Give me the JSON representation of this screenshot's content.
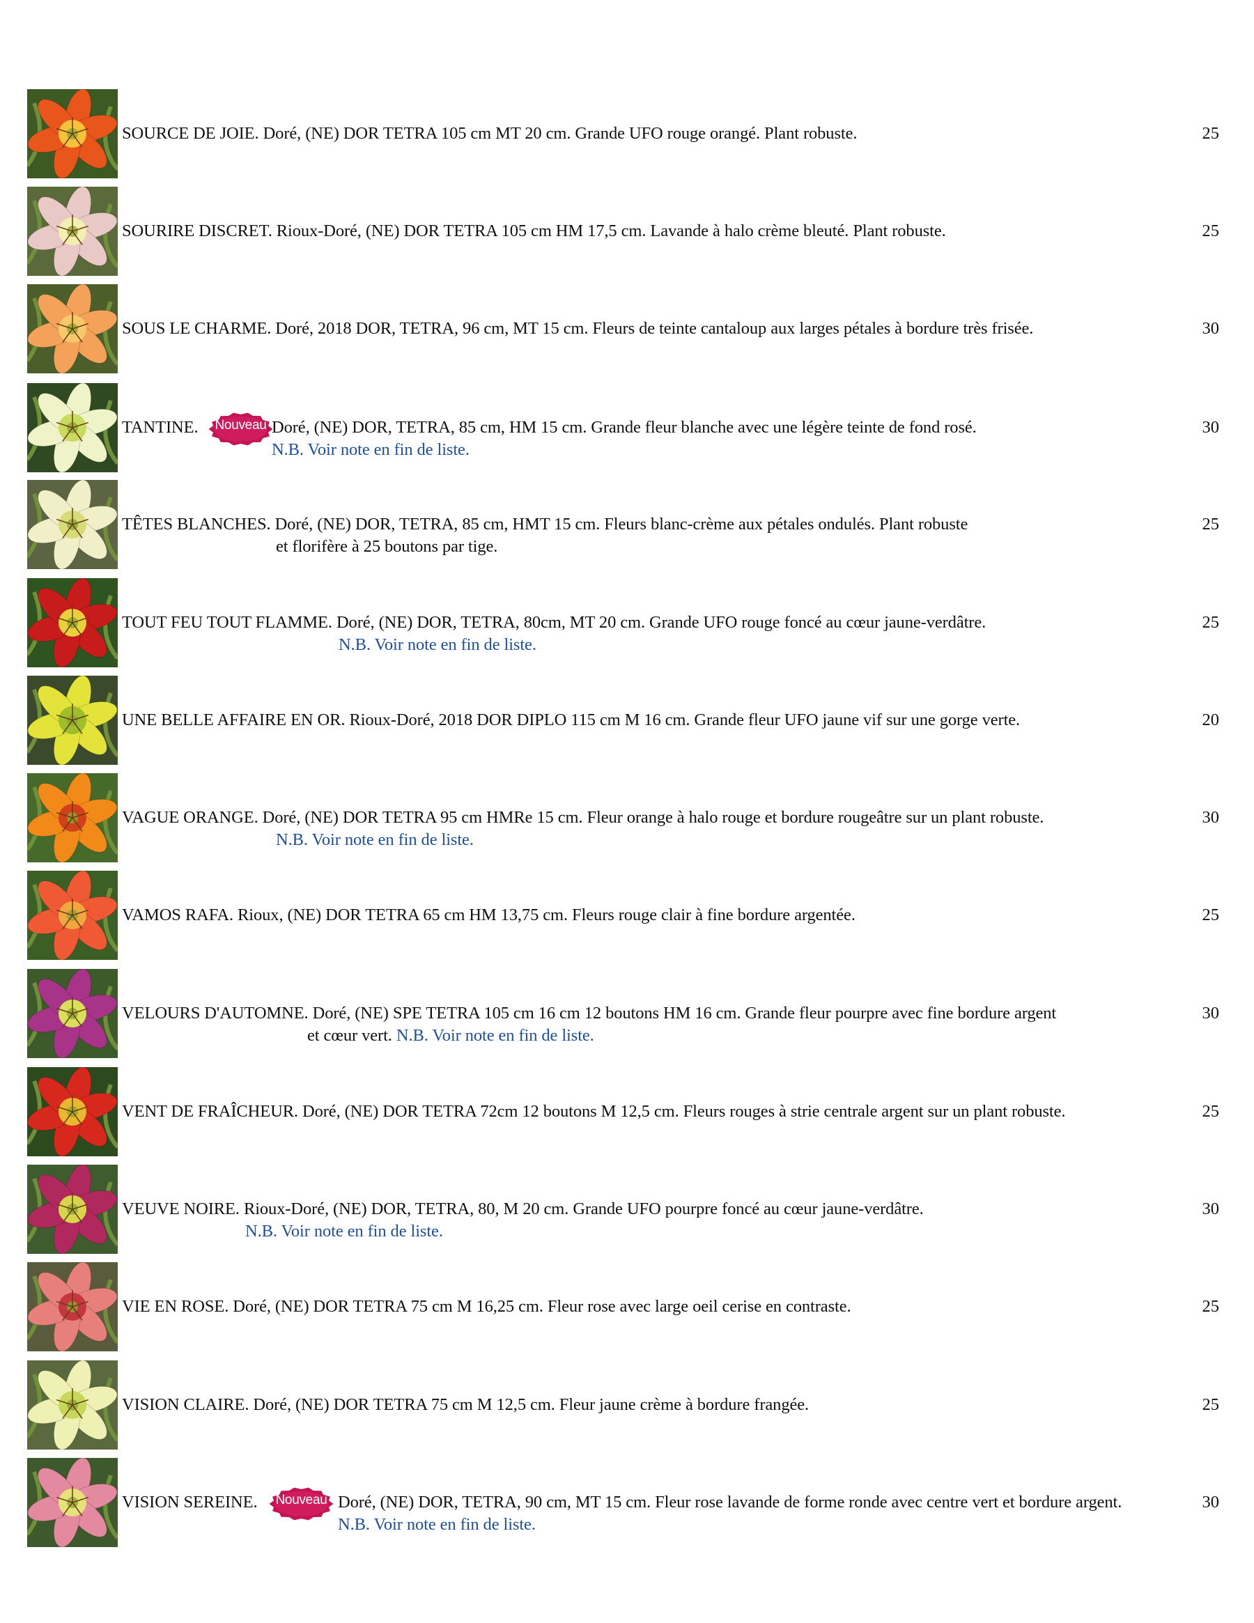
{
  "catalog": {
    "entries": [
      {
        "name": "SOURCE DE JOIE.",
        "description": "Doré, (NE) DOR TETRA 105 cm MT 20 cm. Grande UFO rouge orangé. Plant robuste.",
        "price": "25",
        "image": "daylily-orange-red-photo",
        "colors": {
          "petal": "#e8561c",
          "center": "#f7c23a",
          "bg": "#3d5a23"
        }
      },
      {
        "name": "SOURIRE DISCRET.",
        "description": "Rioux-Doré, (NE) DOR TETRA 105 cm HM 17,5 cm. Lavande à halo crème bleuté. Plant robuste.",
        "price": "25",
        "image": "daylily-lavender-cream-photo",
        "colors": {
          "petal": "#e9c9c6",
          "center": "#f3efb0",
          "bg": "#5a6a3a"
        }
      },
      {
        "name": "SOUS LE CHARME.",
        "description": "Doré, 2018 DOR, TETRA, 96 cm, MT 15 cm. Fleurs de teinte cantaloup aux larges pétales à bordure très frisée.",
        "price": "30",
        "image": "daylily-cantaloupe-ruffled-photo",
        "colors": {
          "petal": "#f4a25a",
          "center": "#f7c96a",
          "bg": "#4c5f2b"
        }
      },
      {
        "name": "TANTINE.",
        "badge": "Nouveau",
        "description": "Doré, (NE) DOR, TETRA, 85 cm, HM 15 cm. Grande fleur blanche avec une légère teinte de fond rosé.",
        "note": "N.B. Voir note en fin de liste.",
        "price": "30",
        "image": "daylily-white-photo",
        "colors": {
          "petal": "#eef3c8",
          "center": "#c9db5e",
          "bg": "#2f4a22"
        }
      },
      {
        "name": "TÊTES BLANCHES.",
        "description": "Doré, (NE) DOR, TETRA, 85 cm, HMT 15 cm. Fleurs blanc-crème aux pétales ondulés. Plant robuste",
        "line2": "et florifère à 25 boutons par tige.",
        "price": "25",
        "image": "daylily-cream-white-photo",
        "colors": {
          "petal": "#f1efc8",
          "center": "#d6dc7a",
          "bg": "#5d6443"
        }
      },
      {
        "name": "TOUT FEU TOUT FLAMME.",
        "description": "Doré, (NE) DOR, TETRA, 80cm, MT 20 cm. Grande UFO rouge foncé au cœur jaune-verdâtre.",
        "note": "N.B. Voir note en fin de liste.",
        "price": "25",
        "image": "daylily-dark-red-photo",
        "colors": {
          "petal": "#c81c1c",
          "center": "#e8d13a",
          "bg": "#2e5520"
        }
      },
      {
        "name": "UNE BELLE AFFAIRE EN OR.",
        "description": "Rioux-Doré, 2018 DOR DIPLO 115 cm M 16 cm. Grande fleur UFO jaune vif sur une gorge verte.",
        "price": "20",
        "image": "daylily-bright-yellow-photo",
        "colors": {
          "petal": "#e3e33a",
          "center": "#9cbf2a",
          "bg": "#3a4a2a"
        }
      },
      {
        "name": "VAGUE ORANGE.",
        "description": "Doré, (NE) DOR TETRA 95 cm HMRe 15 cm. Fleur orange à halo rouge et bordure rougeâtre sur un plant robuste.",
        "note": "N.B. Voir note en fin de liste.",
        "price": "30",
        "image": "daylily-orange-halo-photo",
        "colors": {
          "petal": "#f28a1a",
          "center": "#d0401a",
          "bg": "#456a2a"
        }
      },
      {
        "name": "VAMOS RAFA.",
        "description": "Rioux, (NE) DOR TETRA 65 cm HM 13,75 cm. Fleurs rouge clair à fine bordure argentée.",
        "price": "25",
        "image": "daylily-light-red-photo",
        "colors": {
          "petal": "#ef5a34",
          "center": "#f2a640",
          "bg": "#3c5f26"
        }
      },
      {
        "name": "VELOURS D'AUTOMNE.",
        "description": "Doré, (NE) SPE TETRA 105 cm 16 cm 12 boutons HM 16 cm. Grande fleur pourpre avec fine bordure argent",
        "line2": "et cœur vert.",
        "note": "N.B. Voir note en fin de liste.",
        "price": "30",
        "image": "daylily-purple-photo",
        "colors": {
          "petal": "#a8348a",
          "center": "#d8e05a",
          "bg": "#3c5a2a"
        }
      },
      {
        "name": "VENT DE FRAÎCHEUR.",
        "description": "Doré, (NE) DOR TETRA 72cm 12 boutons M 12,5 cm. Fleurs rouges à strie centrale argent sur un plant robuste.",
        "price": "25",
        "image": "daylily-red-striped-photo",
        "colors": {
          "petal": "#d6281c",
          "center": "#e8b92e",
          "bg": "#2c4a1e"
        }
      },
      {
        "name": "VEUVE NOIRE.",
        "description": "Rioux-Doré, (NE) DOR, TETRA, 80, M 20 cm. Grande UFO pourpre foncé au cœur jaune-verdâtre.",
        "note": "N.B. Voir note en fin de liste.",
        "price": "30",
        "image": "daylily-dark-purple-photo",
        "colors": {
          "petal": "#b0285e",
          "center": "#d7d54a",
          "bg": "#3f5c2e"
        }
      },
      {
        "name": "VIE EN ROSE.",
        "description": "Doré, (NE) DOR TETRA 75 cm M 16,25 cm. Fleur rose avec large oeil cerise en contraste.",
        "price": "25",
        "image": "daylily-pink-cherry-eye-photo",
        "colors": {
          "petal": "#e7807a",
          "center": "#c4373e",
          "bg": "#5a5a3c"
        }
      },
      {
        "name": "VISION CLAIRE.",
        "description": "Doré, (NE) DOR TETRA 75 cm M 12,5 cm. Fleur jaune crème à bordure frangée.",
        "price": "25",
        "image": "daylily-cream-yellow-photo",
        "colors": {
          "petal": "#eef0b4",
          "center": "#c6d85a",
          "bg": "#5a6a3e"
        }
      },
      {
        "name": "VISION SEREINE.",
        "badge": "Nouveau",
        "description": "Doré, (NE) DOR, TETRA, 90 cm, MT 15 cm. Fleur rose lavande de forme ronde avec centre vert et bordure argent.",
        "note": "N.B. Voir note en fin de liste.",
        "price": "30",
        "image": "daylily-pink-lavender-photo",
        "colors": {
          "petal": "#e48aa0",
          "center": "#e6e27a",
          "bg": "#3e5a2c"
        }
      }
    ]
  }
}
